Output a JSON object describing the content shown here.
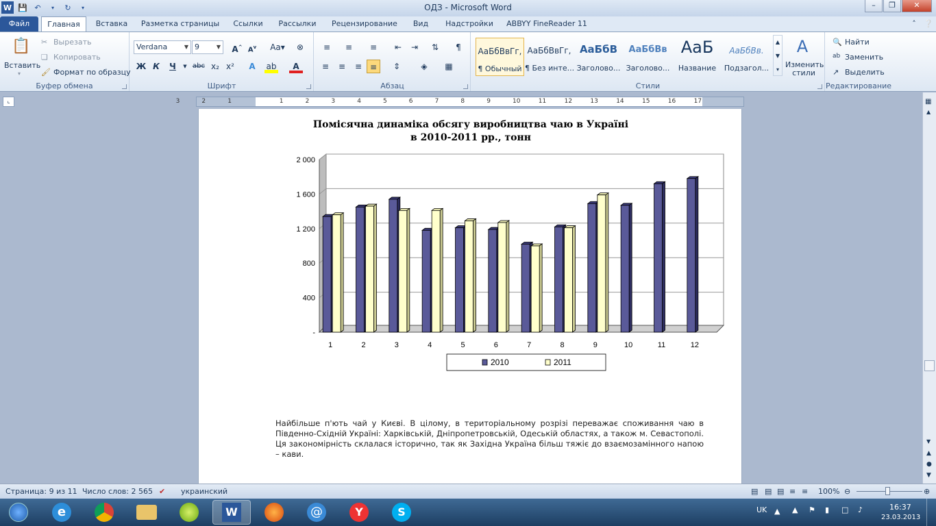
{
  "window": {
    "title": "ОДЗ  -  Microsoft Word"
  },
  "qat": {
    "save": "save-icon",
    "undo": "undo-icon",
    "redo": "redo-icon"
  },
  "tabs": [
    {
      "label": "Файл"
    },
    {
      "label": "Главная"
    },
    {
      "label": "Вставка"
    },
    {
      "label": "Разметка страницы"
    },
    {
      "label": "Ссылки"
    },
    {
      "label": "Рассылки"
    },
    {
      "label": "Рецензирование"
    },
    {
      "label": "Вид"
    },
    {
      "label": "Надстройки"
    },
    {
      "label": "ABBYY FineReader 11"
    }
  ],
  "clipboard": {
    "paste": "Вставить",
    "cut": "Вырезать",
    "copy": "Копировать",
    "format_painter": "Формат по образцу",
    "label": "Буфер обмена"
  },
  "font": {
    "name": "Verdana",
    "size": "9",
    "label": "Шрифт",
    "bold": "Ж",
    "italic": "К",
    "underline": "Ч",
    "strike": "abc",
    "sub": "x₂",
    "sup": "x²"
  },
  "paragraph_group": {
    "label": "Абзац"
  },
  "styles": {
    "label": "Стили",
    "items": [
      {
        "sample": "АаБбВвГг,",
        "name": "¶ Обычный"
      },
      {
        "sample": "АаБбВвГг,",
        "name": "¶ Без инте..."
      },
      {
        "sample": "АаБбВ",
        "name": "Заголово..."
      },
      {
        "sample": "АаБбВв",
        "name": "Заголово..."
      },
      {
        "sample": "АаБ",
        "name": "Название"
      },
      {
        "sample": "АаБбВв.",
        "name": "Подзагол..."
      }
    ],
    "change": "Изменить стили"
  },
  "editing": {
    "label": "Редактирование",
    "find": "Найти",
    "replace": "Заменить",
    "select": "Выделить"
  },
  "ruler": {
    "numbers": [
      "3",
      "2",
      "1",
      "1",
      "2",
      "3",
      "4",
      "5",
      "6",
      "7",
      "8",
      "9",
      "10",
      "11",
      "12",
      "13",
      "14",
      "15",
      "16",
      "17"
    ]
  },
  "document": {
    "chart_title_line1": "Помісячна динаміка обсягу виробництва чаю в Україні",
    "chart_title_line2": "в 2010-2011 рр., тонн",
    "paragraph": "Найбільше п'ють чай у Києві. В цілому, в територіальному розрізі переважає споживання чаю в Південно-Східній Україні: Харківській, Дніпропетровській, Одеській областях, а також м. Севастополі. Ця закономірність склалася історично, так як Західна Україна більш тяжіє до взаємозамінного напою – кави."
  },
  "chart_data": {
    "type": "bar",
    "categories": [
      "1",
      "2",
      "3",
      "4",
      "5",
      "6",
      "7",
      "8",
      "9",
      "10",
      "11",
      "12"
    ],
    "series": [
      {
        "name": "2010",
        "values": [
          1340,
          1450,
          1540,
          1180,
          1210,
          1190,
          1020,
          1220,
          1490,
          1470,
          1720,
          1780
        ],
        "color": "#5a5a99"
      },
      {
        "name": "2011",
        "values": [
          1360,
          1460,
          1410,
          1410,
          1290,
          1270,
          1000,
          1210,
          1590,
          null,
          null,
          null
        ],
        "color": "#ffffcc"
      }
    ],
    "y_ticks": [
      "-",
      "400",
      "800",
      "1 200",
      "1 600",
      "2 000"
    ],
    "ylim": [
      0,
      2000
    ],
    "legend": "bottom",
    "grid": true
  },
  "status": {
    "page": "Страница: 9 из 11",
    "words": "Число слов: 2 565",
    "language": "украинский",
    "zoom": "100%"
  },
  "taskbar": {
    "lang": "UK",
    "time": "16:37",
    "date": "23.03.2013"
  }
}
